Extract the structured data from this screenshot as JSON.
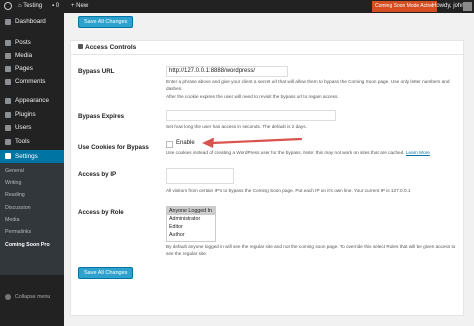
{
  "adminbar": {
    "site_name": "Testing",
    "comments_count": "0",
    "new_label": "New",
    "coming_soon_badge": "Coming Soon Mode Active",
    "howdy": "Howdy, john"
  },
  "sidebar": {
    "items": [
      {
        "label": "Dashboard",
        "icon": "dashboard-icon"
      },
      {
        "label": "Posts",
        "icon": "pin-icon"
      },
      {
        "label": "Media",
        "icon": "media-icon"
      },
      {
        "label": "Pages",
        "icon": "page-icon"
      },
      {
        "label": "Comments",
        "icon": "comment-icon"
      },
      {
        "label": "Appearance",
        "icon": "brush-icon"
      },
      {
        "label": "Plugins",
        "icon": "plugin-icon"
      },
      {
        "label": "Users",
        "icon": "user-icon"
      },
      {
        "label": "Tools",
        "icon": "wrench-icon"
      },
      {
        "label": "Settings",
        "icon": "settings-icon"
      }
    ],
    "submenu": [
      "General",
      "Writing",
      "Reading",
      "Discussion",
      "Media",
      "Permalinks",
      "Coming Soon Pro"
    ],
    "collapse_label": "Collapse menu"
  },
  "buttons": {
    "save_top": "Save All Changes",
    "save_bottom": "Save All Changes"
  },
  "panel": {
    "title": "Access Controls"
  },
  "fields": {
    "bypass_url": {
      "label": "Bypass URL",
      "value": "http://127.0.0.1:8888/wordpress/",
      "desc1": "Enter a phrase above and give your client a secret url that will allow them to bypass the Coming Soon page. Use only letter numbers and dashes.",
      "desc2": "After the cookie expires the user will need to revisit the bypass url to regain access."
    },
    "bypass_expires": {
      "label": "Bypass Expires",
      "value": "",
      "desc": "Set how long the user has access in seconds. The default is 2 days."
    },
    "use_cookies": {
      "label": "Use Cookies for Bypass",
      "checkbox_label": "Enable",
      "checked": false,
      "desc": "Use cookies instead of creating a WordPress user for the bypass. Note: this may not work on sites that are cached.",
      "link": "Learn More"
    },
    "access_by_ip": {
      "label": "Access by IP",
      "value": "",
      "desc": "All visitors from certain IP's to bypass the Coming Soon page. Put each IP on it's own line. Your current IP is 127.0.0.1"
    },
    "access_by_role": {
      "label": "Access by Role",
      "options": [
        "Anyone Logged In",
        "Administrator",
        "Editor",
        "Author"
      ],
      "selected": "Anyone Logged In",
      "desc": "By default anyone logged in will see the regular site and not the coming soon page. To override this select Roles that will be given access to see the regular site."
    }
  },
  "colors": {
    "adminbar_bg": "#222222",
    "sidebar_bg": "#222222",
    "active_menu": "#0074a2",
    "button": "#2ea2cc",
    "badge": "#d54e21",
    "arrow": "#d9534f"
  }
}
